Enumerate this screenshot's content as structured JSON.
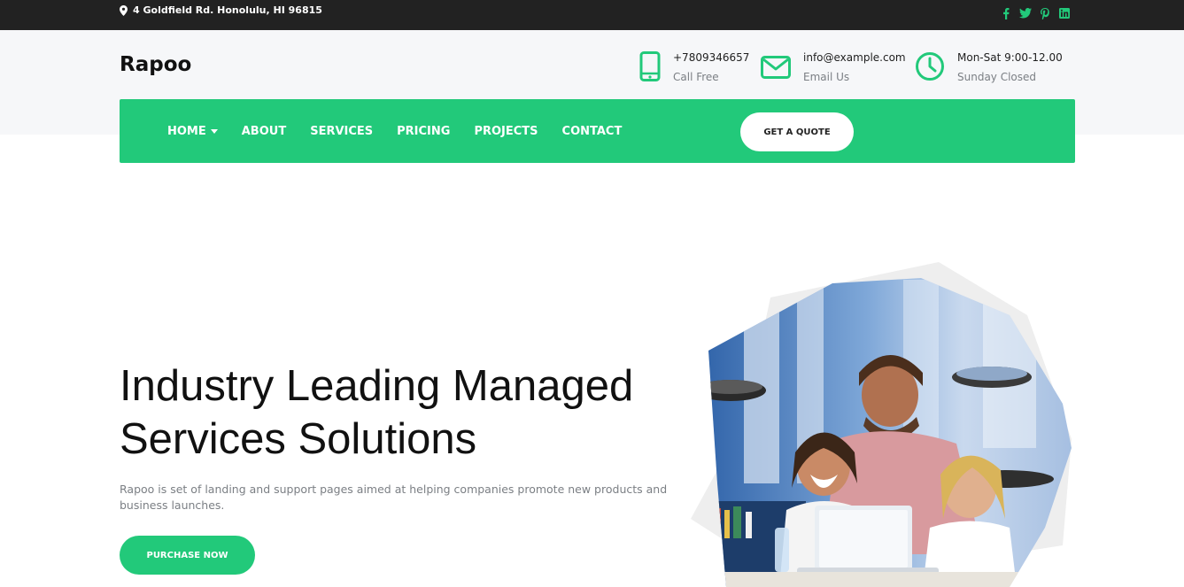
{
  "topbar": {
    "address": "4 Goldfield Rd. Honolulu, HI 96815",
    "social_icons": [
      "facebook-icon",
      "twitter-icon",
      "pinterest-icon",
      "linkedin-icon"
    ]
  },
  "header": {
    "logo": "Rapoo",
    "phone": {
      "value": "+7809346657",
      "label": "Call Free"
    },
    "email": {
      "value": "info@example.com",
      "label": "Email Us"
    },
    "hours": {
      "value": "Mon-Sat 9:00-12.00",
      "label": "Sunday Closed"
    }
  },
  "nav": {
    "items": [
      "HOME",
      "ABOUT",
      "SERVICES",
      "PRICING",
      "PROJECTS",
      "CONTACT"
    ],
    "quote_label": "GET A QUOTE"
  },
  "hero": {
    "title_line1": "Industry Leading Managed",
    "title_line2": "Services Solutions",
    "description": "Rapoo is set of landing and support pages aimed at helping companies promote new products and business launches.",
    "cta_label": "PURCHASE NOW"
  },
  "colors": {
    "accent": "#22c97a",
    "topbar": "#222222",
    "header_bg": "#f6f7f9"
  }
}
